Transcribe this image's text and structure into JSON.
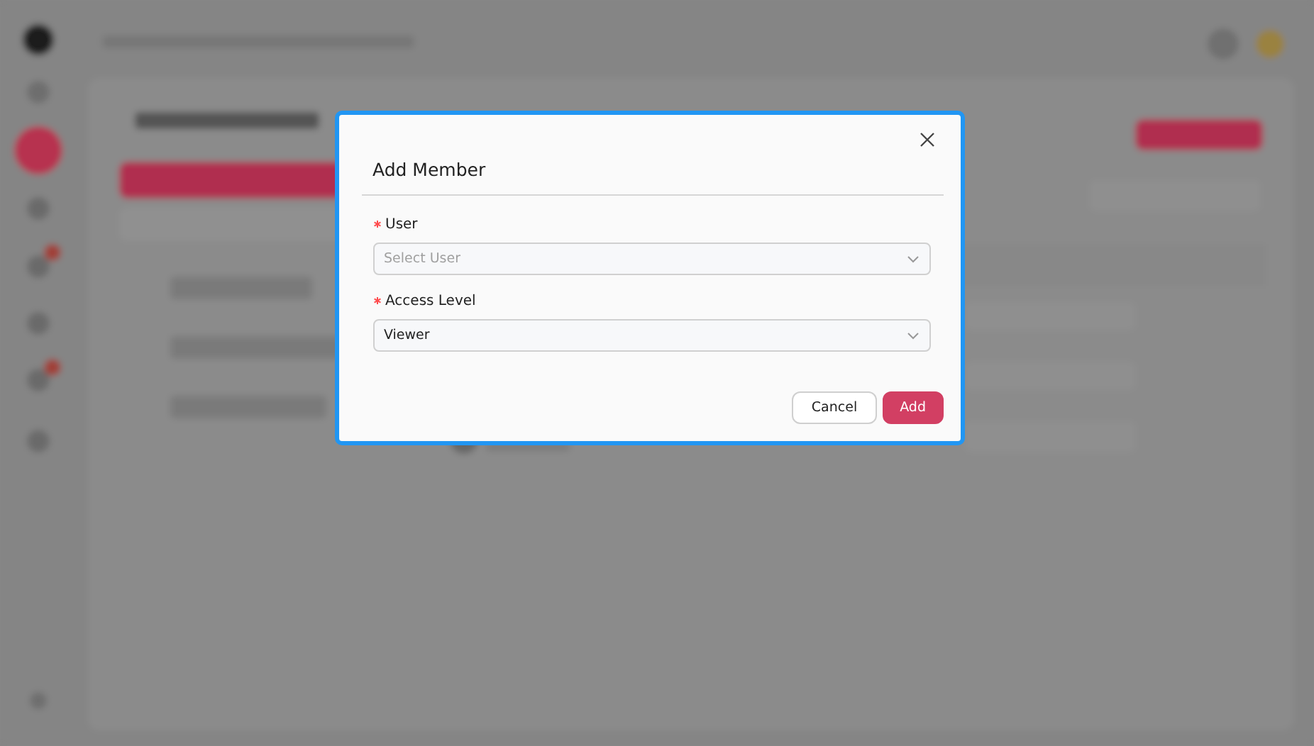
{
  "dialog": {
    "title": "Add Member",
    "fields": [
      {
        "label": "User",
        "required": true,
        "placeholder": "Select User"
      },
      {
        "label": "Access Level",
        "required": true,
        "value": "Viewer"
      }
    ],
    "buttons": [
      {
        "label": "Cancel",
        "kind": "secondary"
      },
      {
        "label": "Add",
        "kind": "primary"
      }
    ]
  }
}
